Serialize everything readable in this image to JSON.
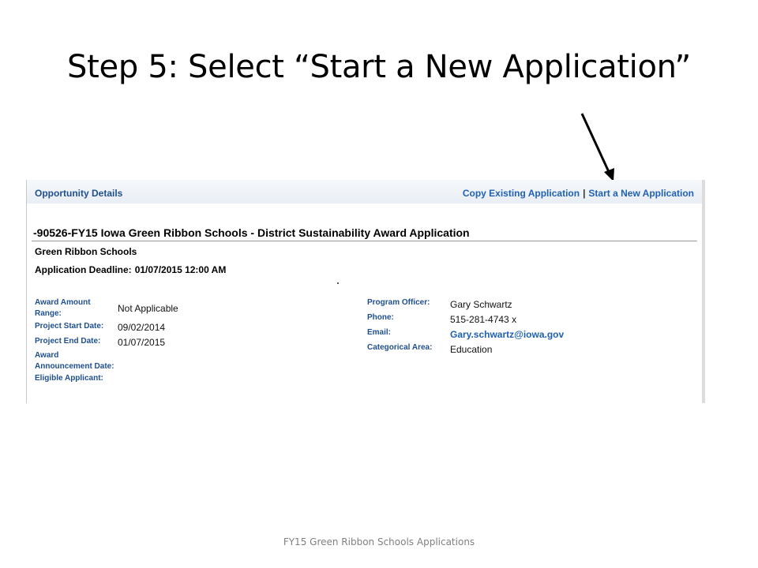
{
  "slide": {
    "title": "Step 5: Select “Start a New Application”",
    "footer": "FY15 Green Ribbon Schools Applications"
  },
  "screenshot": {
    "header": {
      "title": "Opportunity Details",
      "copy_link": "Copy Existing Application",
      "separator": "|",
      "start_link": "Start a New Application"
    },
    "program_title": "-90526-FY15 Iowa Green Ribbon Schools - District Sustainability Award Application",
    "program_name": "Green Ribbon Schools",
    "deadline_label": "Application Deadline:",
    "deadline_value": "01/07/2015 12:00 AM",
    "details_left": {
      "award_amount_label_1": "Award Amount",
      "award_amount_label_2": "Range:",
      "award_amount_value": "Not Applicable",
      "project_start_label": "Project Start Date:",
      "project_start_value": "09/02/2014",
      "project_end_label": "Project End Date:",
      "project_end_value": "01/07/2015",
      "award_announce_label_1": "Award",
      "award_announce_label_2": "Announcement Date:",
      "eligible_label": "Eligible Applicant:"
    },
    "details_right": {
      "officer_label": "Program Officer:",
      "officer_value": "Gary Schwartz",
      "phone_label": "Phone:",
      "phone_value": "515-281-4743 x",
      "email_label": "Email:",
      "email_value": "Gary.schwartz@iowa.gov",
      "category_label": "Categorical Area:",
      "category_value": "Education"
    }
  }
}
